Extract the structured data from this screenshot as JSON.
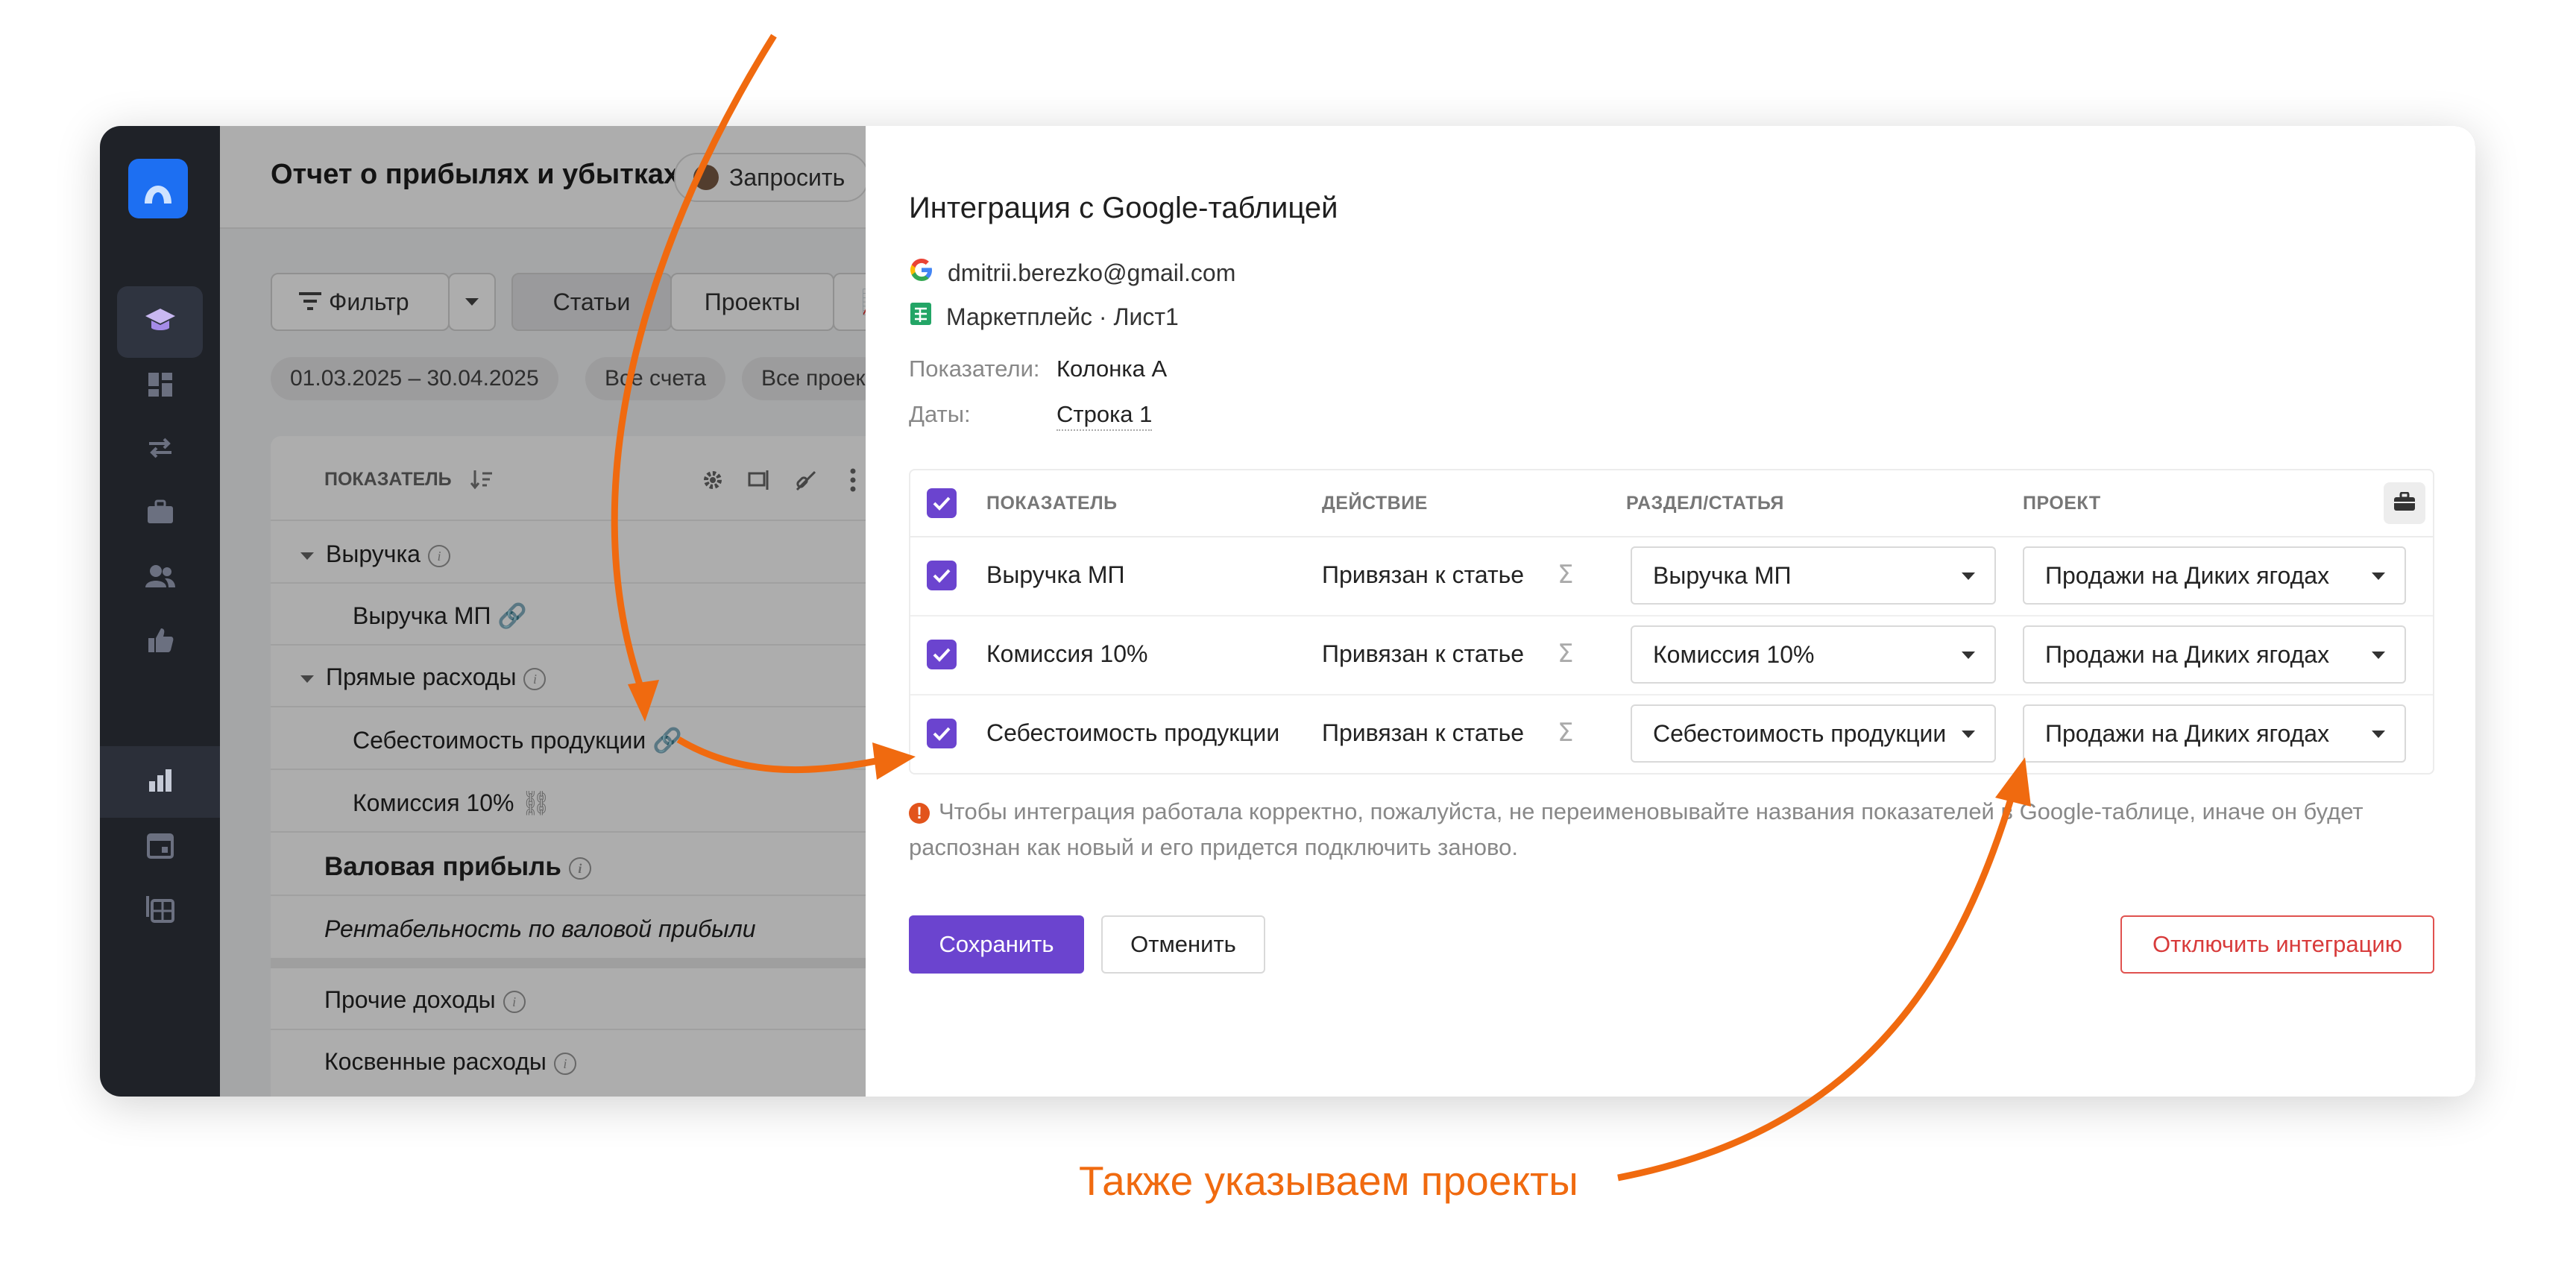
{
  "background": {
    "title": "Отчет о прибылях и убытках",
    "request_button": "Запросить",
    "filter_label": "Фильтр",
    "tabs": [
      "Статьи",
      "Проекты",
      "📈 А"
    ],
    "chips": [
      "01.03.2025 – 30.04.2025",
      "Все счета",
      "Все проек"
    ],
    "column_header": "ПОКАЗАТЕЛЬ",
    "rows": [
      "Выручка",
      "Выручка МП",
      "Прямые расходы",
      "Себестоимость продукции",
      "Комиссия 10%",
      "Валовая прибыль",
      "Рентабельность по валовой прибыли",
      "Прочие доходы",
      "Косвенные расходы"
    ]
  },
  "modal": {
    "title": "Интеграция с Google-таблицей",
    "account_email": "dmitrii.berezko@gmail.com",
    "sheet_name": "Маркетплейс · Лист1",
    "indicators_label": "Показатели:",
    "indicators_value": "Колонка А",
    "dates_label": "Даты:",
    "dates_value": "Строка 1",
    "table": {
      "headers": {
        "indicator": "ПОКАЗАТЕЛЬ",
        "action": "ДЕЙСТВИЕ",
        "section": "РАЗДЕЛ/СТАТЬЯ",
        "project": "ПРОЕКТ"
      },
      "rows": [
        {
          "indicator": "Выручка МП",
          "action": "Привязан к статье",
          "symbol": "Σ",
          "section": "Выручка МП",
          "project": "Продажи на Диких ягодах"
        },
        {
          "indicator": "Комиссия 10%",
          "action": "Привязан к статье",
          "symbol": "Σ",
          "section": "Комиссия 10%",
          "project": "Продажи на Диких ягодах"
        },
        {
          "indicator": "Себестоимость продукции",
          "action": "Привязан к статье",
          "symbol": "Σ",
          "section": "Себестоимость продукции",
          "project": "Продажи на Диких ягодах"
        }
      ]
    },
    "warning": "Чтобы интеграция работала корректно, пожалуйста, не переименовывайте названия показателей в Google-таблице, иначе он будет распознан как новый и его придется подключить заново.",
    "save_button": "Сохранить",
    "cancel_button": "Отменить",
    "disconnect_button": "Отключить интеграцию"
  },
  "annotation": {
    "caption": "Также указываем проекты",
    "color": "#f06a0f"
  },
  "colors": {
    "accent": "#6b44cf",
    "danger": "#d83b3b",
    "sidebar": "#1f2228"
  }
}
